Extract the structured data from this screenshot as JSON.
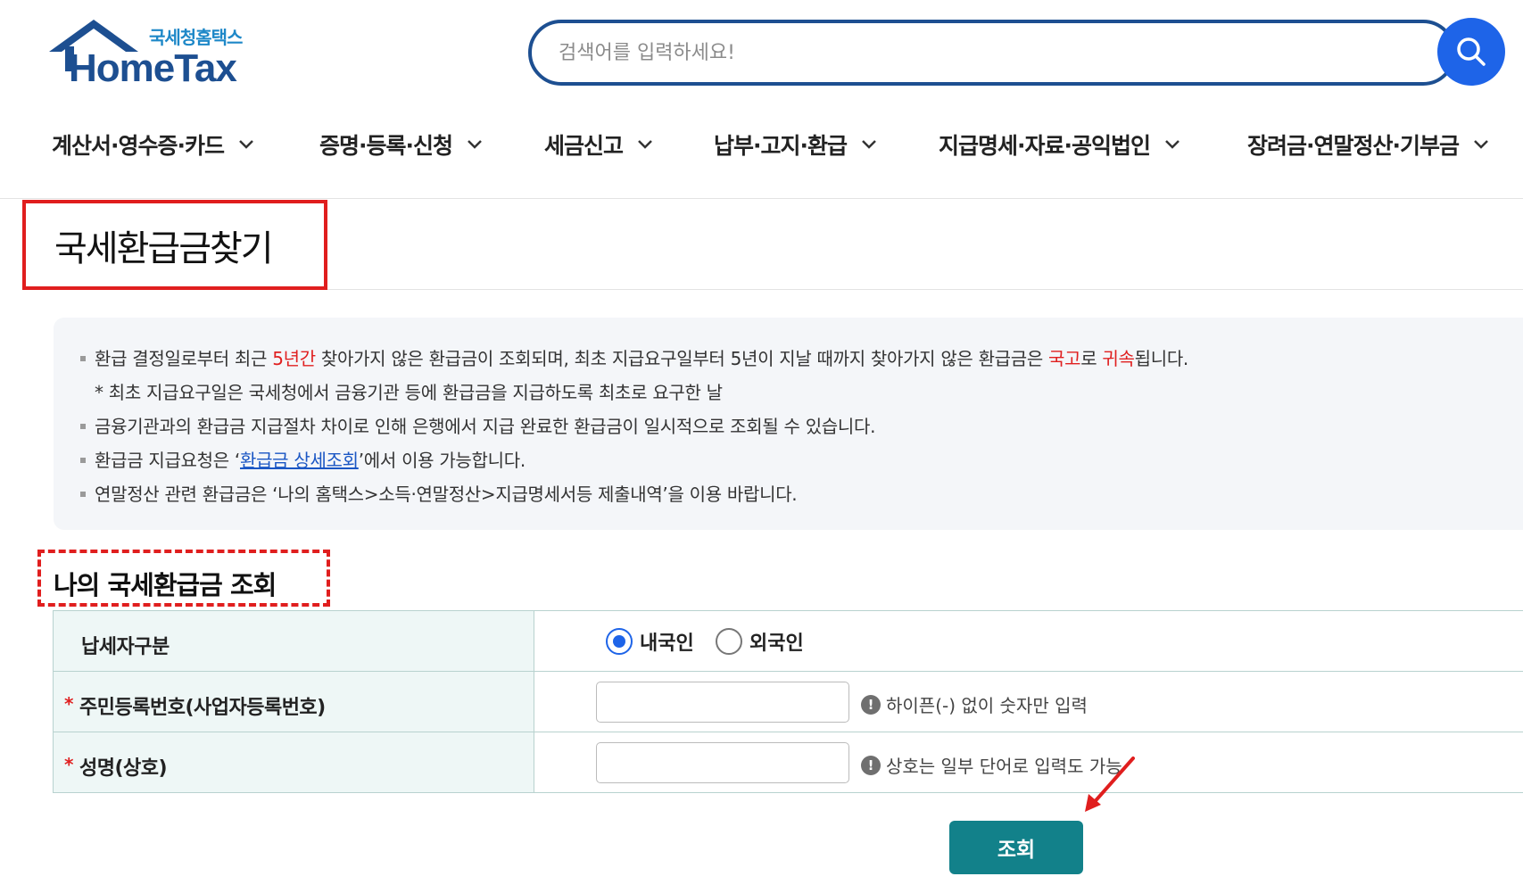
{
  "header": {
    "logo_sub": "국세청홈택스",
    "logo_main": "HomeTax",
    "search_placeholder": "검색어를 입력하세요!",
    "search_icon": "search-icon"
  },
  "gnb": {
    "items": [
      "계산서·영수증·카드",
      "증명·등록·신청",
      "세금신고",
      "납부·고지·환급",
      "지급명세·자료·공익법인",
      "장려금·연말정산·기부금"
    ]
  },
  "page": {
    "title": "국세환급금찾기"
  },
  "notice": {
    "line1_a": "환급 결정일로부터 최근 ",
    "line1_red1": "5년간",
    "line1_b": " 찾아가지 않은 환급금이 조회되며, 최초 지급요구일부터 5년이 지날 때까지 찾아가지 않은 환급금은 ",
    "line1_red2": "국고",
    "line1_c": "로 ",
    "line1_red3": "귀속",
    "line1_d": "됩니다.",
    "line2": "* 최초 지급요구일은 국세청에서 금융기관 등에 환급금을 지급하도록 최초로 요구한 날",
    "line3": "금융기관과의 환급금 지급절차 차이로 인해 은행에서 지급 완료한 환급금이 일시적으로 조회될 수 있습니다.",
    "line4_a": "환급금 지급요청은 ‘",
    "line4_link": "환급금 상세조회",
    "line4_b": "’에서 이용 가능합니다.",
    "line5": "연말정산 관련 환급금은 ‘나의 홈택스>소득·연말정산>지급명세서등 제출내역’을 이용 바랍니다."
  },
  "form": {
    "section_title": "나의 국세환급금 조회",
    "row1_label": "납세자구분",
    "radio_domestic": "내국인",
    "radio_foreign": "외국인",
    "radio_selected": "내국인",
    "row2_label": "주민등록번호(사업자등록번호)",
    "row2_hint": "하이픈(-) 없이 숫자만 입력",
    "row3_label": "성명(상호)",
    "row3_hint": "상호는 일부 단어로 입력도 가능",
    "required_mark": "*",
    "submit": "조회"
  },
  "colors": {
    "brand_navy": "#1d4f91",
    "search_blue": "#1e64e8",
    "submit_teal": "#12818a",
    "highlight_red": "#e01e1e"
  }
}
